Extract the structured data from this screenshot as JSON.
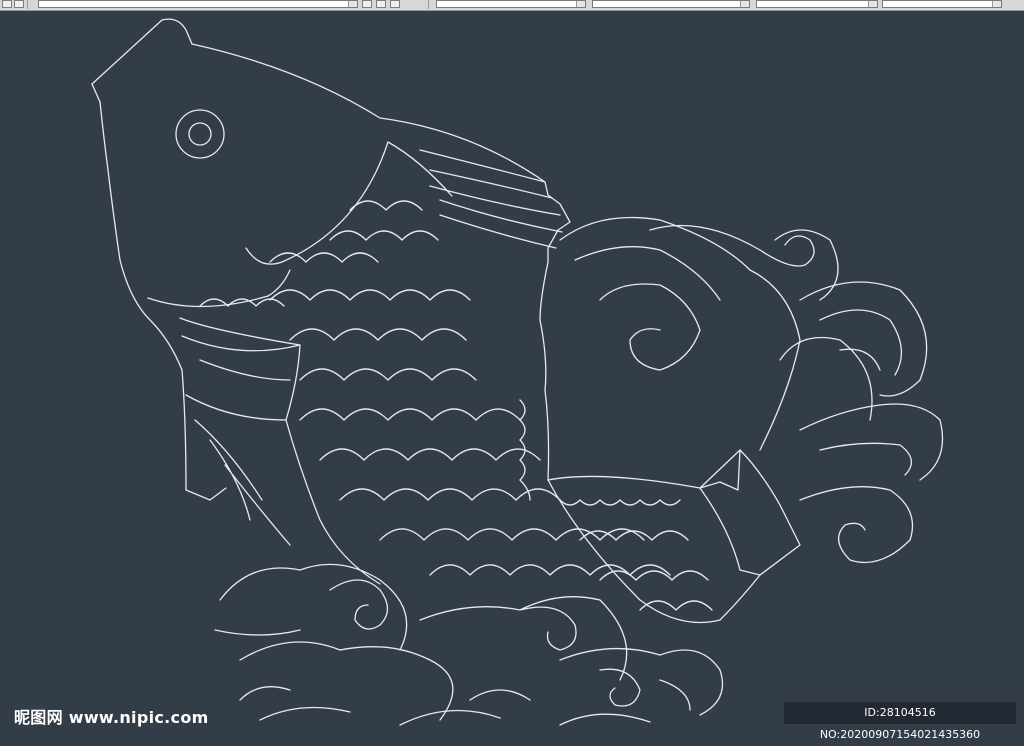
{
  "toolbar": {
    "combos": [
      "",
      "",
      "",
      "",
      ""
    ]
  },
  "drawing": {
    "background_color": "#333d48",
    "line_color": "#e6eaee",
    "subject": "carp-fish-with-waves-line-art"
  },
  "watermark": {
    "site": "昵图网 www.nipic.com",
    "id_text": "ID:28104516 NO:20200907154021435360"
  }
}
